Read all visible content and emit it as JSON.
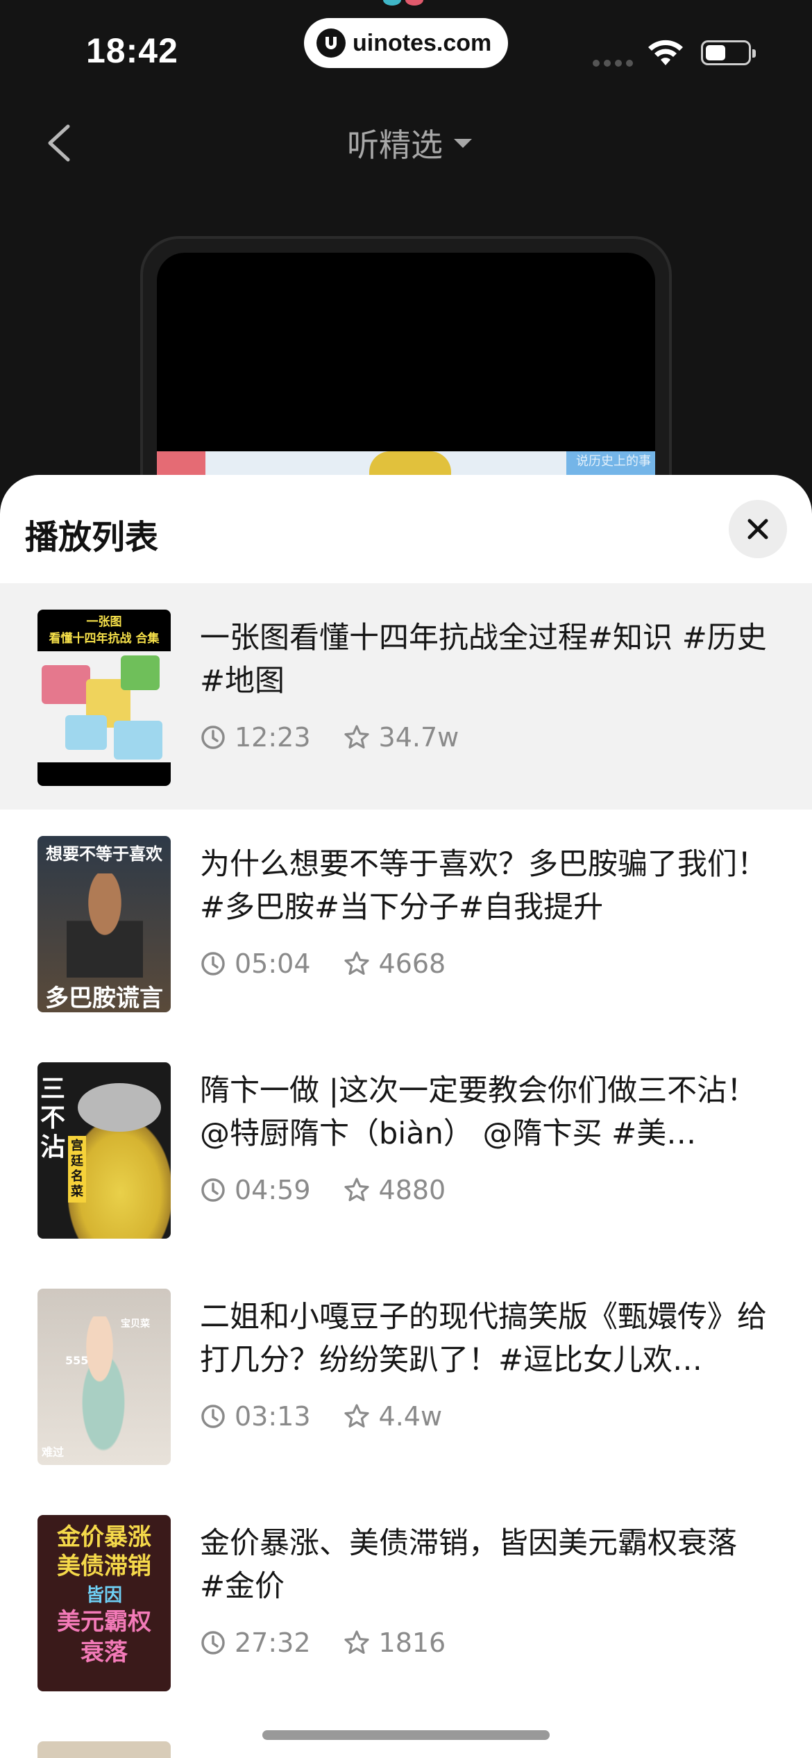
{
  "status_bar": {
    "time": "18:42",
    "url": "uinotes.com"
  },
  "nav": {
    "title": "听精选"
  },
  "video_overlay_text": "说历史上的事",
  "playlist": {
    "title": "播放列表",
    "items": [
      {
        "title": "一张图看懂十四年抗战全过程#知识 #历史 #地图",
        "duration": "12:23",
        "favorites": "34.7w",
        "active": true,
        "thumb_lines": [
          "一张图",
          "看懂十四年抗战 合集"
        ]
      },
      {
        "title": "为什么想要不等于喜欢？多巴胺骗了我们！ #多巴胺#当下分子#自我提升",
        "duration": "05:04",
        "favorites": "4668",
        "active": false,
        "thumb_lines": [
          "想要不等于喜欢",
          "多巴胺谎言"
        ]
      },
      {
        "title": "隋卞一做 |这次一定要教会你们做三不沾！@特厨隋卞（biàn） @隋卞买 #美…",
        "duration": "04:59",
        "favorites": "4880",
        "active": false,
        "thumb_lines": [
          "三不沾",
          "宫廷名菜"
        ]
      },
      {
        "title": "二姐和小嘎豆子的现代搞笑版《甄嬛传》给打几分？纷纷笑趴了！#逗比女儿欢…",
        "duration": "03:13",
        "favorites": "4.4w",
        "active": false,
        "thumb_lines": [
          "555",
          "宝贝菜",
          "难过"
        ]
      },
      {
        "title": "金价暴涨、美债滞销，皆因美元霸权衰落 #金价",
        "duration": "27:32",
        "favorites": "1816",
        "active": false,
        "thumb_lines": [
          "金价暴涨",
          "美债滞销",
          "皆因",
          "美元霸权",
          "衰落"
        ]
      }
    ]
  },
  "colors": {
    "background": "#141414",
    "sheet": "#ffffff",
    "active_row": "#f2f2f2",
    "meta_text": "#8a8a8a"
  }
}
